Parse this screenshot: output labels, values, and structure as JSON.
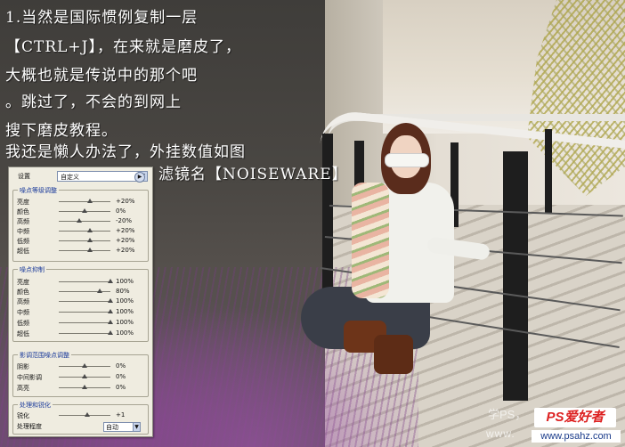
{
  "text_lines": [
    "1.当然是国际惯例复制一层",
    "【CTRL+J】，在来就是磨皮了，",
    "大概也就是传说中的那个吧",
    "。跳过了，不会的到网上",
    "搜下磨皮教程。",
    "我还是懒人办法了，外挂数值如图",
    "滤镜名【NOISEWARE】"
  ],
  "panel": {
    "setting_label": "设置",
    "preset_value": "自定义",
    "groups": [
      {
        "title": "噪点等级调整",
        "rows": [
          {
            "label": "亮度",
            "value": "+20%",
            "level": 0.6
          },
          {
            "label": "颜色",
            "value": "0%",
            "level": 0.5
          },
          {
            "label": "高频",
            "value": "-20%",
            "level": 0.4
          },
          {
            "label": "中频",
            "value": "+20%",
            "level": 0.6
          },
          {
            "label": "低频",
            "value": "+20%",
            "level": 0.6
          },
          {
            "label": "超低",
            "value": "+20%",
            "level": 0.6
          }
        ]
      },
      {
        "title": "噪点抑制",
        "rows": [
          {
            "label": "亮度",
            "value": "100%",
            "level": 1.0
          },
          {
            "label": "颜色",
            "value": "80%",
            "level": 0.8
          },
          {
            "label": "高频",
            "value": "100%",
            "level": 1.0
          },
          {
            "label": "中频",
            "value": "100%",
            "level": 1.0
          },
          {
            "label": "低频",
            "value": "100%",
            "level": 1.0
          },
          {
            "label": "超低",
            "value": "100%",
            "level": 1.0
          }
        ]
      },
      {
        "title": "影调范围噪点调整",
        "rows": [
          {
            "label": "阴影",
            "value": "0%",
            "level": 0.5
          },
          {
            "label": "中间影调",
            "value": "0%",
            "level": 0.5
          },
          {
            "label": "高亮",
            "value": "0%",
            "level": 0.5
          }
        ]
      },
      {
        "title": "处理和锐化",
        "rows": [
          {
            "label": "锐化",
            "value": "+1",
            "level": 0.55
          }
        ],
        "mode_label": "处理程度",
        "mode_value": "自动"
      }
    ]
  },
  "watermark": {
    "line1": "学PS，",
    "logo": "PS爱好者",
    "line2": "www.",
    "url": "www.psahz.com"
  },
  "colors": {
    "group_title": "#1a3a9a",
    "panel_bg": "#efece0"
  }
}
